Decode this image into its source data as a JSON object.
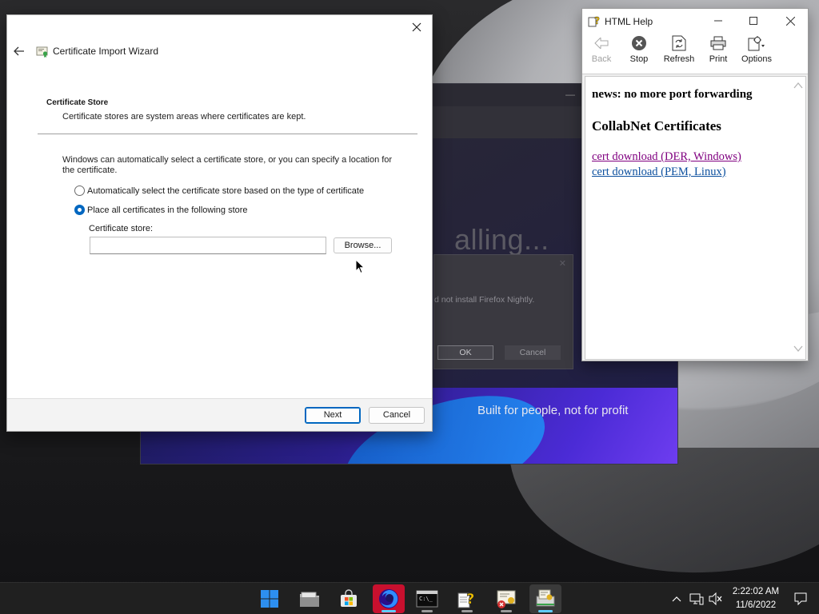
{
  "wizard": {
    "title": "Certificate Import Wizard",
    "section_heading": "Certificate Store",
    "section_desc": "Certificate stores are system areas where certificates are kept.",
    "intro": "Windows can automatically select a certificate store, or you can specify a location for the certificate.",
    "radio_auto_label": "Automatically select the certificate store based on the type of certificate",
    "radio_place_label": "Place all certificates in the following store",
    "selected_option": "place",
    "store_label": "Certificate store:",
    "store_value": "",
    "browse_label": "Browse...",
    "next_label": "Next",
    "cancel_label": "Cancel"
  },
  "help": {
    "title": "HTML Help",
    "toolbar": {
      "back": "Back",
      "stop": "Stop",
      "refresh": "Refresh",
      "print": "Print",
      "options": "Options"
    },
    "content": {
      "news": "news: no more port forwarding",
      "heading": "CollabNet Certificates",
      "links": [
        {
          "text": "cert download (DER, Windows)",
          "color": "#800080"
        },
        {
          "text": "cert download (PEM, Linux)",
          "color": "#0b4f9e"
        }
      ]
    }
  },
  "installer": {
    "heading": "alling...",
    "tagline": "Built for people, not for profit",
    "error_text": "d not install Firefox Nightly.",
    "ok_label": "OK",
    "cancel_label": "Cancel"
  },
  "taskbar": {
    "apps": [
      {
        "name": "start-button",
        "icon": "windows-logo-icon"
      },
      {
        "name": "file-explorer",
        "icon": "folder-icon"
      },
      {
        "name": "microsoft-store",
        "icon": "store-bag-icon"
      },
      {
        "name": "firefox-nightly",
        "icon": "firefox-icon"
      },
      {
        "name": "command-prompt",
        "icon": "terminal-icon"
      },
      {
        "name": "html-help",
        "icon": "help-question-icon"
      },
      {
        "name": "certificate-error",
        "icon": "certificate-error-icon"
      },
      {
        "name": "certificate-import",
        "icon": "certificate-import-icon"
      }
    ],
    "clock_time": "2:22:02 AM",
    "clock_date": "11/6/2022"
  },
  "colors": {
    "accent": "#0067c0",
    "taskbar_active_indicator": "#60cdff",
    "visited_link": "#800080",
    "link": "#0b4f9e"
  }
}
